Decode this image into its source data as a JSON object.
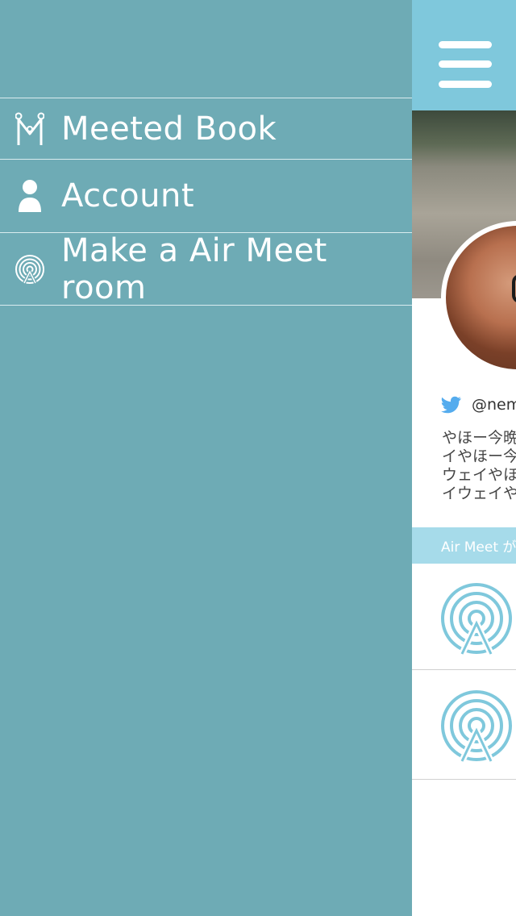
{
  "drawer": {
    "items": [
      {
        "label": "Meeted Book",
        "icon": "meeted-book-icon"
      },
      {
        "label": "Account",
        "icon": "account-icon"
      },
      {
        "label": "Make a Air Meet room",
        "icon": "air-meet-icon"
      }
    ]
  },
  "content": {
    "menu_icon": "hamburger-menu-icon",
    "profile": {
      "twitter_handle": "@nemu",
      "bio": "やほー今晩\nイやほー今\nウェイやほ\nイウェイや"
    },
    "section_header": "Air Meet が",
    "rooms": [
      {
        "icon": "air-meet-icon"
      },
      {
        "icon": "air-meet-icon"
      }
    ]
  },
  "colors": {
    "drawer_bg": "#6eabb5",
    "topbar_bg": "#7fc8dc",
    "accent": "#7fc8dc",
    "section_header_bg": "#a6dbea",
    "twitter_blue": "#55acee"
  }
}
